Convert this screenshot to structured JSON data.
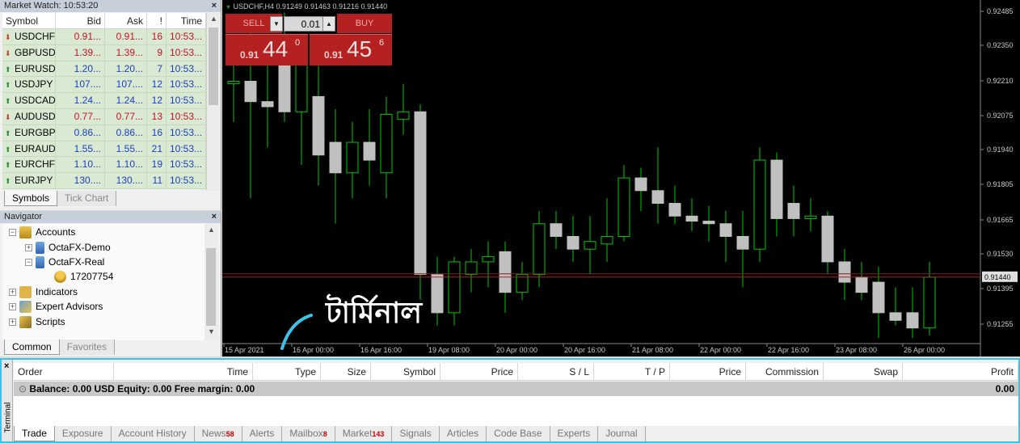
{
  "market_watch": {
    "title": "Market Watch: 10:53:20",
    "headers": {
      "symbol": "Symbol",
      "bid": "Bid",
      "ask": "Ask",
      "spread": "!",
      "time": "Time"
    },
    "rows": [
      {
        "dir": "down",
        "symbol": "USDCHF",
        "bid": "0.91...",
        "ask": "0.91...",
        "spread": "16",
        "time": "10:53...",
        "color": "red"
      },
      {
        "dir": "down",
        "symbol": "GBPUSD",
        "bid": "1.39...",
        "ask": "1.39...",
        "spread": "9",
        "time": "10:53...",
        "color": "red"
      },
      {
        "dir": "up",
        "symbol": "EURUSD",
        "bid": "1.20...",
        "ask": "1.20...",
        "spread": "7",
        "time": "10:53...",
        "color": "blue"
      },
      {
        "dir": "up",
        "symbol": "USDJPY",
        "bid": "107....",
        "ask": "107....",
        "spread": "12",
        "time": "10:53...",
        "color": "blue"
      },
      {
        "dir": "up",
        "symbol": "USDCAD",
        "bid": "1.24...",
        "ask": "1.24...",
        "spread": "12",
        "time": "10:53...",
        "color": "blue"
      },
      {
        "dir": "down",
        "symbol": "AUDUSD",
        "bid": "0.77...",
        "ask": "0.77...",
        "spread": "13",
        "time": "10:53...",
        "color": "red"
      },
      {
        "dir": "up",
        "symbol": "EURGBP",
        "bid": "0.86...",
        "ask": "0.86...",
        "spread": "16",
        "time": "10:53...",
        "color": "blue"
      },
      {
        "dir": "up",
        "symbol": "EURAUD",
        "bid": "1.55...",
        "ask": "1.55...",
        "spread": "21",
        "time": "10:53...",
        "color": "blue"
      },
      {
        "dir": "up",
        "symbol": "EURCHF",
        "bid": "1.10...",
        "ask": "1.10...",
        "spread": "19",
        "time": "10:53...",
        "color": "blue"
      },
      {
        "dir": "up",
        "symbol": "EURJPY",
        "bid": "130....",
        "ask": "130....",
        "spread": "11",
        "time": "10:53...",
        "color": "blue"
      }
    ],
    "tabs": [
      "Symbols",
      "Tick Chart"
    ]
  },
  "navigator": {
    "title": "Navigator",
    "items": {
      "accounts": "Accounts",
      "demo": "OctaFX-Demo",
      "real": "OctaFX-Real",
      "account_no": "17207754",
      "indicators": "Indicators",
      "experts": "Expert Advisors",
      "scripts": "Scripts"
    },
    "tabs": [
      "Common",
      "Favorites"
    ]
  },
  "chart": {
    "title": "USDCHF,H4  0.91249 0.91463 0.91216 0.91440",
    "trade": {
      "sell_label": "SELL",
      "buy_label": "BUY",
      "lot": "0.01",
      "sell_prefix": "0.91",
      "sell_big": "44",
      "sell_sup": "0",
      "buy_prefix": "0.91",
      "buy_big": "45",
      "buy_sup": "6"
    },
    "callout": "টার্মিনাল",
    "price_labels": [
      "0.92485",
      "0.92350",
      "0.92210",
      "0.92075",
      "0.91940",
      "0.91805",
      "0.91665",
      "0.91530",
      "0.91395",
      "0.91255"
    ],
    "current_price": "0.91440",
    "time_labels": [
      "15 Apr 2021",
      "16 Apr 00:00",
      "16 Apr 16:00",
      "19 Apr 08:00",
      "20 Apr 00:00",
      "20 Apr 16:00",
      "21 Apr 08:00",
      "22 Apr 00:00",
      "22 Apr 16:00",
      "23 Apr 08:00",
      "26 Apr 00:00"
    ],
    "colors": {
      "up_body": "#000000",
      "down_body": "#c0c0c0",
      "wick": "#00c800",
      "current_line": "#b02020",
      "background": "#000000"
    }
  },
  "chart_data": {
    "type": "candlestick",
    "symbol": "USDCHF",
    "timeframe": "H4",
    "ylim": [
      0.9118,
      0.9255
    ],
    "candles": [
      {
        "o": 0.922,
        "h": 0.9235,
        "l": 0.9205,
        "c": 0.9221
      },
      {
        "o": 0.9221,
        "h": 0.924,
        "l": 0.9175,
        "c": 0.9213
      },
      {
        "o": 0.9213,
        "h": 0.9228,
        "l": 0.9195,
        "c": 0.9211
      },
      {
        "o": 0.9228,
        "h": 0.9248,
        "l": 0.9205,
        "c": 0.9209
      },
      {
        "o": 0.9209,
        "h": 0.9222,
        "l": 0.9188,
        "c": 0.923
      },
      {
        "o": 0.9215,
        "h": 0.9228,
        "l": 0.918,
        "c": 0.9192
      },
      {
        "o": 0.9197,
        "h": 0.921,
        "l": 0.9165,
        "c": 0.9185
      },
      {
        "o": 0.9185,
        "h": 0.9205,
        "l": 0.9175,
        "c": 0.9197
      },
      {
        "o": 0.9197,
        "h": 0.921,
        "l": 0.918,
        "c": 0.919
      },
      {
        "o": 0.9185,
        "h": 0.9215,
        "l": 0.9175,
        "c": 0.9208
      },
      {
        "o": 0.9206,
        "h": 0.922,
        "l": 0.92,
        "c": 0.9209
      },
      {
        "o": 0.9209,
        "h": 0.9212,
        "l": 0.9135,
        "c": 0.9145
      },
      {
        "o": 0.9145,
        "h": 0.9152,
        "l": 0.9125,
        "c": 0.913
      },
      {
        "o": 0.913,
        "h": 0.9152,
        "l": 0.9125,
        "c": 0.915
      },
      {
        "o": 0.9145,
        "h": 0.9155,
        "l": 0.9138,
        "c": 0.915
      },
      {
        "o": 0.915,
        "h": 0.9158,
        "l": 0.914,
        "c": 0.9152
      },
      {
        "o": 0.9154,
        "h": 0.9158,
        "l": 0.913,
        "c": 0.9138
      },
      {
        "o": 0.9138,
        "h": 0.915,
        "l": 0.9135,
        "c": 0.9145
      },
      {
        "o": 0.9145,
        "h": 0.917,
        "l": 0.914,
        "c": 0.9165
      },
      {
        "o": 0.9165,
        "h": 0.917,
        "l": 0.9155,
        "c": 0.916
      },
      {
        "o": 0.916,
        "h": 0.9168,
        "l": 0.915,
        "c": 0.9155
      },
      {
        "o": 0.9155,
        "h": 0.9168,
        "l": 0.9145,
        "c": 0.9158
      },
      {
        "o": 0.9157,
        "h": 0.9175,
        "l": 0.915,
        "c": 0.916
      },
      {
        "o": 0.916,
        "h": 0.9188,
        "l": 0.9158,
        "c": 0.9183
      },
      {
        "o": 0.9183,
        "h": 0.9187,
        "l": 0.917,
        "c": 0.9178
      },
      {
        "o": 0.9178,
        "h": 0.9195,
        "l": 0.9165,
        "c": 0.9173
      },
      {
        "o": 0.9173,
        "h": 0.918,
        "l": 0.9165,
        "c": 0.9168
      },
      {
        "o": 0.9168,
        "h": 0.9175,
        "l": 0.9162,
        "c": 0.9166
      },
      {
        "o": 0.9166,
        "h": 0.9172,
        "l": 0.9158,
        "c": 0.9165
      },
      {
        "o": 0.9165,
        "h": 0.917,
        "l": 0.915,
        "c": 0.916
      },
      {
        "o": 0.916,
        "h": 0.917,
        "l": 0.914,
        "c": 0.9155
      },
      {
        "o": 0.9155,
        "h": 0.9195,
        "l": 0.915,
        "c": 0.919
      },
      {
        "o": 0.919,
        "h": 0.9193,
        "l": 0.916,
        "c": 0.9167
      },
      {
        "o": 0.9173,
        "h": 0.918,
        "l": 0.916,
        "c": 0.9167
      },
      {
        "o": 0.9167,
        "h": 0.9175,
        "l": 0.9162,
        "c": 0.9168
      },
      {
        "o": 0.9168,
        "h": 0.917,
        "l": 0.9145,
        "c": 0.915
      },
      {
        "o": 0.915,
        "h": 0.9155,
        "l": 0.9135,
        "c": 0.9142
      },
      {
        "o": 0.9144,
        "h": 0.915,
        "l": 0.9135,
        "c": 0.9138
      },
      {
        "o": 0.9142,
        "h": 0.9148,
        "l": 0.912,
        "c": 0.913
      },
      {
        "o": 0.913,
        "h": 0.914,
        "l": 0.9125,
        "c": 0.9127
      },
      {
        "o": 0.913,
        "h": 0.914,
        "l": 0.912,
        "c": 0.9124
      },
      {
        "o": 0.9124,
        "h": 0.915,
        "l": 0.9121,
        "c": 0.9144
      }
    ]
  },
  "terminal": {
    "side_label": "Terminal",
    "columns": [
      "Order",
      "Time",
      "Type",
      "Size",
      "Symbol",
      "Price",
      "S / L",
      "T / P",
      "Price",
      "Commission",
      "Swap",
      "Profit"
    ],
    "balance_text": "Balance: 0.00 USD  Equity: 0.00  Free margin: 0.00",
    "profit_total": "0.00",
    "tabs": [
      {
        "label": "Trade",
        "badge": ""
      },
      {
        "label": "Exposure",
        "badge": ""
      },
      {
        "label": "Account History",
        "badge": ""
      },
      {
        "label": "News",
        "badge": "58"
      },
      {
        "label": "Alerts",
        "badge": ""
      },
      {
        "label": "Mailbox",
        "badge": "8"
      },
      {
        "label": "Market",
        "badge": "143"
      },
      {
        "label": "Signals",
        "badge": ""
      },
      {
        "label": "Articles",
        "badge": ""
      },
      {
        "label": "Code Base",
        "badge": ""
      },
      {
        "label": "Experts",
        "badge": ""
      },
      {
        "label": "Journal",
        "badge": ""
      }
    ],
    "border_color": "#3cc3e6"
  }
}
